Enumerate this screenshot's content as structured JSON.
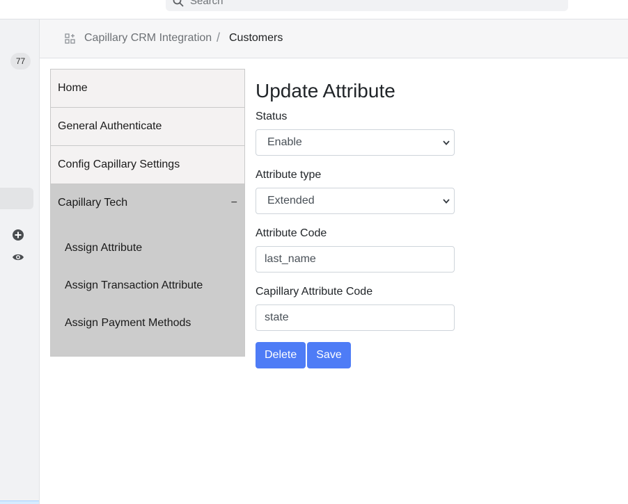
{
  "topbar": {
    "search_placeholder": "Search"
  },
  "rail": {
    "badge_count": "77"
  },
  "breadcrumb": {
    "app": "Capillary CRM Integration",
    "separator": "/",
    "current": "Customers"
  },
  "menu": {
    "items": [
      {
        "label": "Home"
      },
      {
        "label": "General Authenticate"
      },
      {
        "label": "Config Capillary Settings"
      },
      {
        "label": "Capillary Tech",
        "toggle": "−"
      }
    ],
    "subitems": [
      {
        "label": "Assign Attribute"
      },
      {
        "label": "Assign Transaction Attribute"
      },
      {
        "label": "Assign Payment Methods"
      }
    ]
  },
  "form": {
    "title": "Update Attribute",
    "status_label": "Status",
    "status_value": "Enable",
    "type_label": "Attribute type",
    "type_value": "Extended",
    "code_label": "Attribute Code",
    "code_value": "last_name",
    "cap_code_label": "Capillary Attribute Code",
    "cap_code_value": "state",
    "delete_label": "Delete",
    "save_label": "Save"
  },
  "colors": {
    "primary": "#4e7cf6",
    "menu_active": "#cccccc",
    "menu_bg": "#f4f2f2"
  }
}
